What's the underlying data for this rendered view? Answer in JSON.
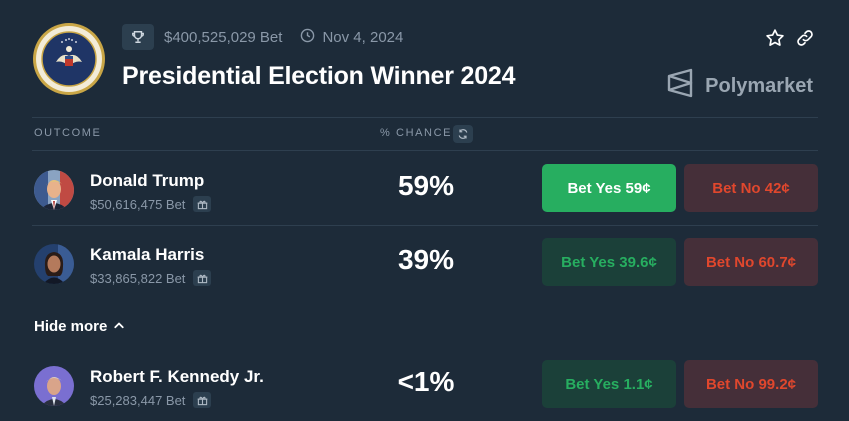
{
  "header": {
    "volume": "$400,525,029 Bet",
    "date": "Nov 4, 2024",
    "title": "Presidential Election Winner 2024",
    "brand": "Polymarket"
  },
  "table": {
    "outcome_header": "OUTCOME",
    "chance_header": "% CHANCE"
  },
  "outcomes": [
    {
      "name": "Donald Trump",
      "volume": "$50,616,475 Bet",
      "chance": "59%",
      "yes_label": "Bet Yes 59¢",
      "no_label": "Bet No 42¢"
    },
    {
      "name": "Kamala Harris",
      "volume": "$33,865,822 Bet",
      "chance": "39%",
      "yes_label": "Bet Yes 39.6¢",
      "no_label": "Bet No 60.7¢"
    },
    {
      "name": "Robert F. Kennedy Jr.",
      "volume": "$25,283,447 Bet",
      "chance": "<1%",
      "yes_label": "Bet Yes 1.1¢",
      "no_label": "Bet No 99.2¢"
    }
  ],
  "hide_more_label": "Hide more",
  "colors": {
    "background": "#1d2b39",
    "yes_green": "#27ae60",
    "no_red": "#e0472d",
    "muted": "#8a98a8"
  },
  "icons": [
    "presidential-seal-icon",
    "trophy-icon",
    "clock-icon",
    "star-icon",
    "link-icon",
    "polymarket-logo-icon",
    "refresh-icon",
    "gift-icon",
    "chevron-up-icon"
  ]
}
